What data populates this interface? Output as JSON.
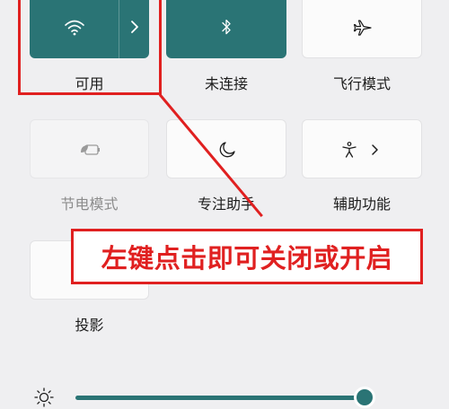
{
  "tiles": {
    "wifi": {
      "label": "可用",
      "state": "on"
    },
    "bluetooth": {
      "label": "未连接",
      "state": "on"
    },
    "airplane": {
      "label": "飞行模式",
      "state": "off"
    },
    "battery_saver": {
      "label": "节电模式",
      "state": "disabled"
    },
    "focus_assist": {
      "label": "专注助手",
      "state": "off"
    },
    "accessibility": {
      "label": "辅助功能",
      "state": "off"
    },
    "project": {
      "label": "投影",
      "state": "off"
    }
  },
  "annotation": {
    "callout_text": "左键点击即可关闭或开启",
    "color": "#e02020"
  },
  "brightness": {
    "level_fraction": 0.95
  },
  "colors": {
    "accent": "#2a7475",
    "background": "#efeff1"
  },
  "icons": {
    "wifi": "wifi-icon",
    "chevron": "chevron-right-icon",
    "bluetooth": "bluetooth-icon",
    "airplane": "airplane-icon",
    "battery_saver": "battery-saver-icon",
    "focus_assist": "moon-icon",
    "accessibility": "accessibility-icon",
    "project": "project-icon",
    "brightness": "sun-icon"
  }
}
